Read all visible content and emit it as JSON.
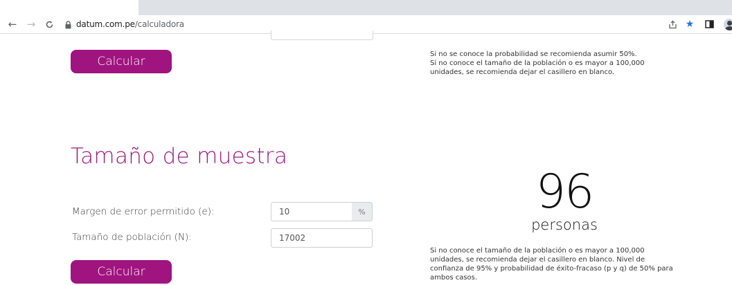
{
  "browser": {
    "url_domain": "datum.com.pe",
    "url_path": "/calculadora",
    "icons": [
      "back-icon",
      "forward-icon",
      "reload-icon",
      "lock-icon",
      "share-icon",
      "star-icon",
      "sidepanel-icon",
      "profile-avatar"
    ],
    "accent": "#1a73e8"
  },
  "top_section": {
    "calc_button_label": "Calcular",
    "note_lines": [
      "Si no se conoce la probabilidad se recomienda asumir 50%.",
      "Si no conoce el tamaño de la población o es mayor a 100,000",
      "unidades, se recomienda dejar el casillero en blanco."
    ]
  },
  "sample_section": {
    "title": "Tamaño de muestra",
    "error_label": "Margen de error permitido (e):",
    "error_value": "10",
    "error_suffix": "%",
    "population_label": "Tamaño de población (N):",
    "population_value": "17002",
    "calc_button_label": "Calcular",
    "result_value": "96",
    "result_unit": "personas",
    "note_lines": [
      "Si no conoce el tamaño de la población o es mayor a 100,000",
      "unidades, se recomienda dejar el casillero en blanco. Nivel de",
      "confianza de 95% y probabilidad de éxito-fracaso (p y q) de 50% para",
      "ambos casos."
    ]
  },
  "colors": {
    "brand": "#a0147f",
    "title": "#9c1a7e"
  }
}
